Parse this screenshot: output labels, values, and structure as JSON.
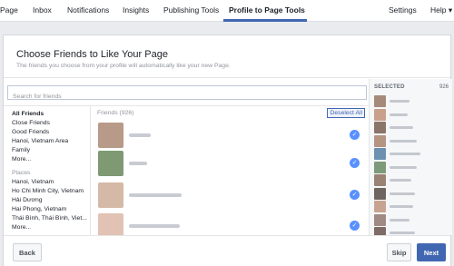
{
  "nav": {
    "tabs": [
      {
        "label": "Page",
        "active": false
      },
      {
        "label": "Inbox",
        "active": false
      },
      {
        "label": "Notifications",
        "active": false
      },
      {
        "label": "Insights",
        "active": false
      },
      {
        "label": "Publishing Tools",
        "active": false
      },
      {
        "label": "Profile to Page Tools",
        "active": true
      }
    ],
    "settings": "Settings",
    "help": "Help ▾"
  },
  "dialog": {
    "title": "Choose Friends to Like Your Page",
    "subtitle": "The friends you choose from your profile will automatically like your new Page.",
    "search_placeholder": "Search for friends"
  },
  "filters": {
    "lists": [
      "All Friends",
      "Close Friends",
      "Good Friends",
      "Hanoi, Vietnam Area",
      "Family",
      "More..."
    ],
    "selected": "All Friends",
    "places_heading": "Places",
    "places": [
      "Hanoi, Vietnam",
      "Ho Chi Minh City, Vietnam",
      "Hải Dương",
      "Hai Phong, Vietnam",
      "Thái Bình, Thái Bình, Viet...",
      "More..."
    ]
  },
  "friends": {
    "header": "Friends (926)",
    "deselect_all": "Deselect All",
    "rows": [
      {
        "avatar_color": "#b89a88",
        "name_width": "blurred",
        "checked": true
      },
      {
        "avatar_color": "#7f9a72",
        "name_width": "blurred",
        "checked": true
      },
      {
        "avatar_color": "#d4b9a6",
        "name_width": "blurred",
        "checked": true
      },
      {
        "avatar_color": "#e2c2b4",
        "name_width": "blurred",
        "checked": true
      }
    ]
  },
  "selected_panel": {
    "label": "SELECTED",
    "count": "926",
    "avatar_colors": [
      "#a58a7c",
      "#c9a08c",
      "#8b7468",
      "#b59482",
      "#6d8fb0",
      "#7d9a7a",
      "#9a8275",
      "#6f6560",
      "#c7a392",
      "#a08a84",
      "#7e6c66"
    ]
  },
  "footer": {
    "back": "Back",
    "skip": "Skip",
    "next": "Next"
  },
  "colors": {
    "brand": "#4267b2",
    "check": "#5890ff",
    "background": "#e9ebee"
  }
}
